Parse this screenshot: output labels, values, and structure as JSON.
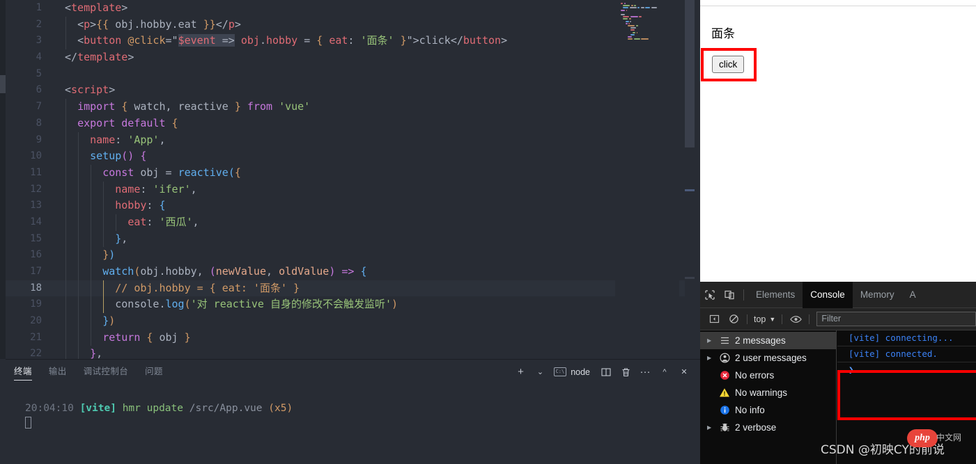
{
  "editor": {
    "language": "vue",
    "active_line": 18,
    "lines": [
      {
        "n": 1,
        "indent": 0,
        "text": "<template>"
      },
      {
        "n": 2,
        "indent": 1,
        "text": "  <p>{{ obj.hobby.eat }}</p>"
      },
      {
        "n": 3,
        "indent": 1,
        "text": "  <button @click=\"$event => obj.hobby = { eat: '面条' }\">click</button>"
      },
      {
        "n": 4,
        "indent": 0,
        "text": "</template>"
      },
      {
        "n": 5,
        "indent": 0,
        "text": ""
      },
      {
        "n": 6,
        "indent": 0,
        "text": "<script>"
      },
      {
        "n": 7,
        "indent": 1,
        "text": "  import { watch, reactive } from 'vue'"
      },
      {
        "n": 8,
        "indent": 1,
        "text": "  export default {"
      },
      {
        "n": 9,
        "indent": 2,
        "text": "    name: 'App',"
      },
      {
        "n": 10,
        "indent": 2,
        "text": "    setup() {"
      },
      {
        "n": 11,
        "indent": 3,
        "text": "      const obj = reactive({"
      },
      {
        "n": 12,
        "indent": 4,
        "text": "        name: 'ifer',"
      },
      {
        "n": 13,
        "indent": 4,
        "text": "        hobby: {"
      },
      {
        "n": 14,
        "indent": 5,
        "text": "          eat: '西瓜',"
      },
      {
        "n": 15,
        "indent": 4,
        "text": "        },"
      },
      {
        "n": 16,
        "indent": 3,
        "text": "      })"
      },
      {
        "n": 17,
        "indent": 3,
        "text": "      watch(obj.hobby, (newValue, oldValue) => {"
      },
      {
        "n": 18,
        "indent": 4,
        "text": "        // obj.hobby = { eat: '面条' }"
      },
      {
        "n": 19,
        "indent": 4,
        "text": "        console.log('对 reactive 自身的修改不会触发监听')"
      },
      {
        "n": 20,
        "indent": 3,
        "text": "      })"
      },
      {
        "n": 21,
        "indent": 3,
        "text": "      return { obj }"
      },
      {
        "n": 22,
        "indent": 2,
        "text": "    },"
      }
    ]
  },
  "panel": {
    "tabs": [
      {
        "label": "终端",
        "active": true
      },
      {
        "label": "输出",
        "active": false
      },
      {
        "label": "调试控制台",
        "active": false
      },
      {
        "label": "问题",
        "active": false
      }
    ],
    "actions": {
      "new_terminal": "+",
      "new_terminal_dropdown": "⌄",
      "active_terminal_name": "node",
      "split": "split-terminal",
      "kill": "kill-terminal",
      "more": "···",
      "maximize": "^",
      "close": "✕"
    },
    "terminal": {
      "time": "20:04:10",
      "tag": "[vite]",
      "message": "hmr update",
      "path": "/src/App.vue",
      "count": "(x5)"
    }
  },
  "browser": {
    "page": {
      "heading": "面条",
      "button_label": "click"
    },
    "devtools": {
      "tabs": [
        {
          "label": "Elements",
          "active": false
        },
        {
          "label": "Console",
          "active": true
        },
        {
          "label": "Memory",
          "active": false
        },
        {
          "label": "A",
          "active": false
        }
      ],
      "toolbar": {
        "sidebar_toggle": "sidebar-icon",
        "clear_console": "no-entry-icon",
        "context": "top",
        "context_caret": "▼",
        "eye": "eye-icon",
        "filter_placeholder": "Filter"
      },
      "sidebar": [
        {
          "label": "2 messages",
          "icon": "list-icon",
          "expandable": true,
          "selected": true
        },
        {
          "label": "2 user messages",
          "icon": "person-icon",
          "expandable": true,
          "selected": false
        },
        {
          "label": "No errors",
          "icon": "error-icon",
          "expandable": false,
          "selected": false
        },
        {
          "label": "No warnings",
          "icon": "warning-icon",
          "expandable": false,
          "selected": false
        },
        {
          "label": "No info",
          "icon": "info-icon",
          "expandable": false,
          "selected": false
        },
        {
          "label": "2 verbose",
          "icon": "bug-icon",
          "expandable": true,
          "selected": false
        }
      ],
      "console_messages": [
        "[vite] connecting...",
        "[vite] connected."
      ],
      "prompt": "❯"
    }
  },
  "watermark": {
    "text": "CSDN @初映CY的前说",
    "logo": "php",
    "logo_cn": "中文网"
  },
  "colors": {
    "editor_bg": "#282c34",
    "annotation_red": "#fe0000",
    "devtools_bg": "#0c0c0c",
    "accent_blue": "#3b82f6"
  }
}
